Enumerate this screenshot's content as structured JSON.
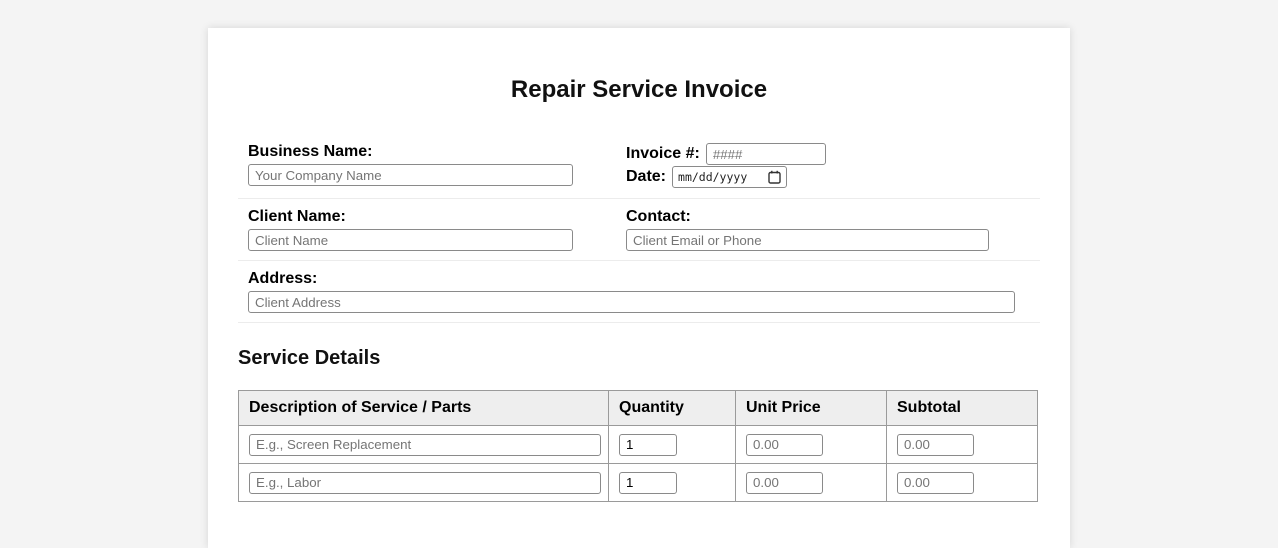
{
  "title": "Repair Service Invoice",
  "top": {
    "business_label": "Business Name:",
    "business_placeholder": "Your Company Name",
    "invoice_label": "Invoice #:",
    "invoice_placeholder": "####",
    "date_label": "Date:",
    "date_value": "mm/dd/yyyy"
  },
  "client": {
    "name_label": "Client Name:",
    "name_placeholder": "Client Name",
    "contact_label": "Contact:",
    "contact_placeholder": "Client Email or Phone"
  },
  "address": {
    "label": "Address:",
    "placeholder": "Client Address"
  },
  "table": {
    "heading": "Service Details",
    "columns": [
      "Description of Service / Parts",
      "Quantity",
      "Unit Price",
      "Subtotal"
    ],
    "rows": [
      {
        "description_ph": "E.g., Screen Replacement",
        "qty": "1",
        "price_ph": "0.00",
        "subtotal_ph": "0.00"
      },
      {
        "description_ph": "E.g., Labor",
        "qty": "1",
        "price_ph": "0.00",
        "subtotal_ph": "0.00"
      }
    ]
  },
  "icons": {
    "calendar": "calendar-icon"
  },
  "colors": {
    "page_bg": "#f4f4f4",
    "card_bg": "#ffffff",
    "table_header_bg": "#eeeeee",
    "table_border": "#9a9a9a",
    "input_border": "#8a8a8a",
    "placeholder_text": "#757575",
    "divider": "#ececec"
  }
}
